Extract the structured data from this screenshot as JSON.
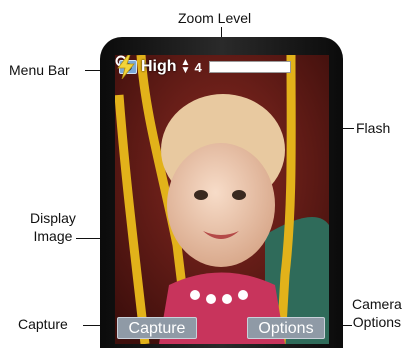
{
  "callouts": {
    "zoom_level": "Zoom Level",
    "menu_bar": "Menu Bar",
    "flash": "Flash",
    "display_image_line1": "Display",
    "display_image_line2": "Image",
    "capture": "Capture",
    "camera_options_line1": "Camera",
    "camera_options_line2": "Options"
  },
  "menubar": {
    "mode_icon": "camera-icon",
    "quality": "High",
    "quality_arrows": [
      "▲",
      "▼"
    ],
    "zoom_icon": "magnifier-icon",
    "zoom_value": "4",
    "zoom_level": 0.0
  },
  "flash": {
    "icon": "lightning-icon",
    "color": "#f2d43a"
  },
  "softkeys": {
    "left": "Capture",
    "right": "Options"
  },
  "colors": {
    "softkey_bg": "#8f9aa6",
    "screen_bg": "#5a1714"
  }
}
